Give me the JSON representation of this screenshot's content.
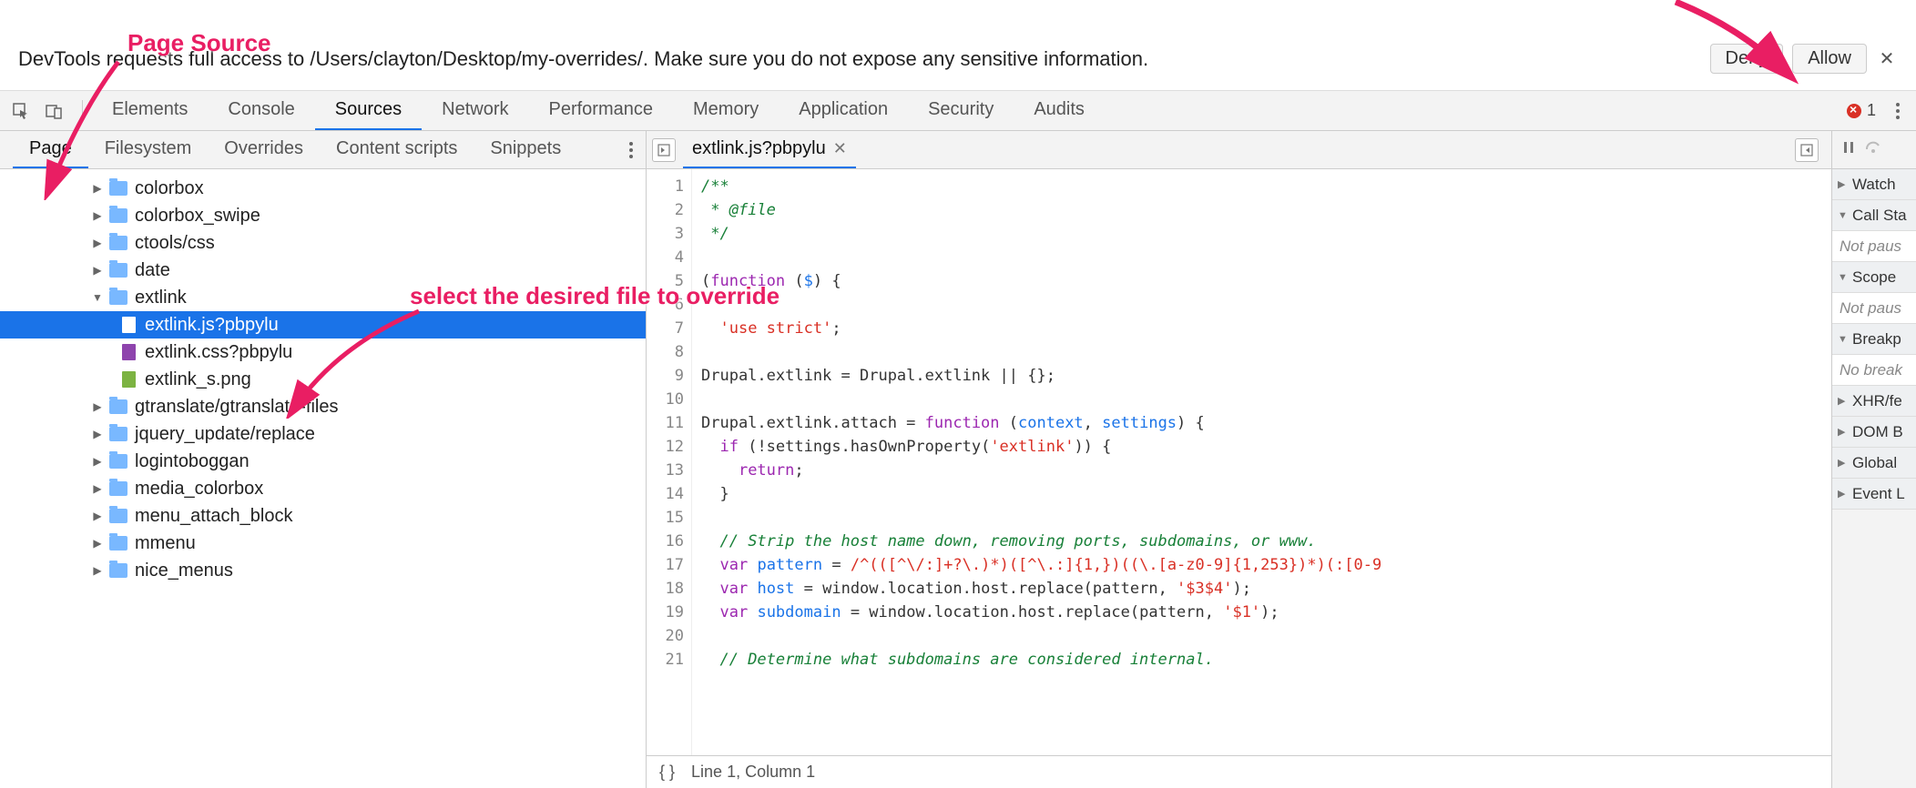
{
  "annotations": {
    "page_source": "Page Source",
    "select_file": "select the desired file to override"
  },
  "prompt": {
    "text": "DevTools requests full access to /Users/clayton/Desktop/my-overrides/. Make sure you do not expose any sensitive information.",
    "deny": "Deny",
    "allow": "Allow"
  },
  "main_tabs": [
    "Elements",
    "Console",
    "Sources",
    "Network",
    "Performance",
    "Memory",
    "Application",
    "Security",
    "Audits"
  ],
  "main_tabs_active": "Sources",
  "error_count": "1",
  "navigator_tabs": [
    "Page",
    "Filesystem",
    "Overrides",
    "Content scripts",
    "Snippets"
  ],
  "navigator_active": "Page",
  "file_tree": [
    {
      "type": "folder",
      "name": "colorbox",
      "depth": 1,
      "expanded": false
    },
    {
      "type": "folder",
      "name": "colorbox_swipe",
      "depth": 1,
      "expanded": false
    },
    {
      "type": "folder",
      "name": "ctools/css",
      "depth": 1,
      "expanded": false
    },
    {
      "type": "folder",
      "name": "date",
      "depth": 1,
      "expanded": false
    },
    {
      "type": "folder",
      "name": "extlink",
      "depth": 1,
      "expanded": true
    },
    {
      "type": "file",
      "name": "extlink.js?pbpylu",
      "depth": 2,
      "kind": "js",
      "selected": true
    },
    {
      "type": "file",
      "name": "extlink.css?pbpylu",
      "depth": 2,
      "kind": "css"
    },
    {
      "type": "file",
      "name": "extlink_s.png",
      "depth": 2,
      "kind": "img"
    },
    {
      "type": "folder",
      "name": "gtranslate/gtranslate-files",
      "depth": 1,
      "expanded": false
    },
    {
      "type": "folder",
      "name": "jquery_update/replace",
      "depth": 1,
      "expanded": false
    },
    {
      "type": "folder",
      "name": "logintoboggan",
      "depth": 1,
      "expanded": false
    },
    {
      "type": "folder",
      "name": "media_colorbox",
      "depth": 1,
      "expanded": false
    },
    {
      "type": "folder",
      "name": "menu_attach_block",
      "depth": 1,
      "expanded": false
    },
    {
      "type": "folder",
      "name": "mmenu",
      "depth": 1,
      "expanded": false
    },
    {
      "type": "folder",
      "name": "nice_menus",
      "depth": 1,
      "expanded": false
    }
  ],
  "editor": {
    "tab_name": "extlink.js?pbpylu",
    "status_cursor": "Line 1, Column 1",
    "format_icon": "{ }",
    "lines": [
      {
        "n": 1,
        "tokens": [
          {
            "c": "cm-comment",
            "t": "/**"
          }
        ]
      },
      {
        "n": 2,
        "tokens": [
          {
            "c": "cm-comment",
            "t": " * @file"
          }
        ]
      },
      {
        "n": 3,
        "tokens": [
          {
            "c": "cm-comment",
            "t": " */"
          }
        ]
      },
      {
        "n": 4,
        "tokens": []
      },
      {
        "n": 5,
        "tokens": [
          {
            "c": "",
            "t": "("
          },
          {
            "c": "cm-keyword",
            "t": "function"
          },
          {
            "c": "",
            "t": " ("
          },
          {
            "c": "cm-def",
            "t": "$"
          },
          {
            "c": "",
            "t": ") {"
          }
        ]
      },
      {
        "n": 6,
        "tokens": []
      },
      {
        "n": 7,
        "tokens": [
          {
            "c": "",
            "t": "  "
          },
          {
            "c": "cm-string",
            "t": "'use strict'"
          },
          {
            "c": "",
            "t": ";"
          }
        ]
      },
      {
        "n": 8,
        "tokens": []
      },
      {
        "n": 9,
        "tokens": [
          {
            "c": "",
            "t": "Drupal.extlink = Drupal.extlink || {};"
          }
        ]
      },
      {
        "n": 10,
        "tokens": []
      },
      {
        "n": 11,
        "tokens": [
          {
            "c": "",
            "t": "Drupal.extlink.attach = "
          },
          {
            "c": "cm-keyword",
            "t": "function"
          },
          {
            "c": "",
            "t": " ("
          },
          {
            "c": "cm-def",
            "t": "context"
          },
          {
            "c": "",
            "t": ", "
          },
          {
            "c": "cm-def",
            "t": "settings"
          },
          {
            "c": "",
            "t": ") {"
          }
        ]
      },
      {
        "n": 12,
        "tokens": [
          {
            "c": "",
            "t": "  "
          },
          {
            "c": "cm-keyword",
            "t": "if"
          },
          {
            "c": "",
            "t": " (!settings.hasOwnProperty("
          },
          {
            "c": "cm-string",
            "t": "'extlink'"
          },
          {
            "c": "",
            "t": ")) {"
          }
        ]
      },
      {
        "n": 13,
        "tokens": [
          {
            "c": "",
            "t": "    "
          },
          {
            "c": "cm-keyword",
            "t": "return"
          },
          {
            "c": "",
            "t": ";"
          }
        ]
      },
      {
        "n": 14,
        "tokens": [
          {
            "c": "",
            "t": "  }"
          }
        ]
      },
      {
        "n": 15,
        "tokens": []
      },
      {
        "n": 16,
        "tokens": [
          {
            "c": "",
            "t": "  "
          },
          {
            "c": "cm-comment",
            "t": "// Strip the host name down, removing ports, subdomains, or www."
          }
        ]
      },
      {
        "n": 17,
        "tokens": [
          {
            "c": "",
            "t": "  "
          },
          {
            "c": "cm-keyword",
            "t": "var"
          },
          {
            "c": "",
            "t": " "
          },
          {
            "c": "cm-var",
            "t": "pattern"
          },
          {
            "c": "",
            "t": " = "
          },
          {
            "c": "cm-string",
            "t": "/^(([^\\/:]+?\\.)*)([^\\.:]{1,})((\\.[a-z0-9]{1,253})*)(:[0-9"
          }
        ]
      },
      {
        "n": 18,
        "tokens": [
          {
            "c": "",
            "t": "  "
          },
          {
            "c": "cm-keyword",
            "t": "var"
          },
          {
            "c": "",
            "t": " "
          },
          {
            "c": "cm-var",
            "t": "host"
          },
          {
            "c": "",
            "t": " = window.location.host.replace(pattern, "
          },
          {
            "c": "cm-string",
            "t": "'$3$4'"
          },
          {
            "c": "",
            "t": ");"
          }
        ]
      },
      {
        "n": 19,
        "tokens": [
          {
            "c": "",
            "t": "  "
          },
          {
            "c": "cm-keyword",
            "t": "var"
          },
          {
            "c": "",
            "t": " "
          },
          {
            "c": "cm-var",
            "t": "subdomain"
          },
          {
            "c": "",
            "t": " = window.location.host.replace(pattern, "
          },
          {
            "c": "cm-string",
            "t": "'$1'"
          },
          {
            "c": "",
            "t": ");"
          }
        ]
      },
      {
        "n": 20,
        "tokens": []
      },
      {
        "n": 21,
        "tokens": [
          {
            "c": "",
            "t": "  "
          },
          {
            "c": "cm-comment",
            "t": "// Determine what subdomains are considered internal."
          }
        ]
      }
    ]
  },
  "debug": {
    "sections": [
      {
        "label": "Watch",
        "expanded": false
      },
      {
        "label": "Call Sta",
        "expanded": true,
        "status": "Not paus"
      },
      {
        "label": "Scope",
        "expanded": true,
        "status": "Not paus"
      },
      {
        "label": "Breakp",
        "expanded": true,
        "status": "No break"
      },
      {
        "label": "XHR/fe",
        "expanded": false
      },
      {
        "label": "DOM B",
        "expanded": false
      },
      {
        "label": "Global",
        "expanded": false
      },
      {
        "label": "Event L",
        "expanded": false
      }
    ]
  }
}
